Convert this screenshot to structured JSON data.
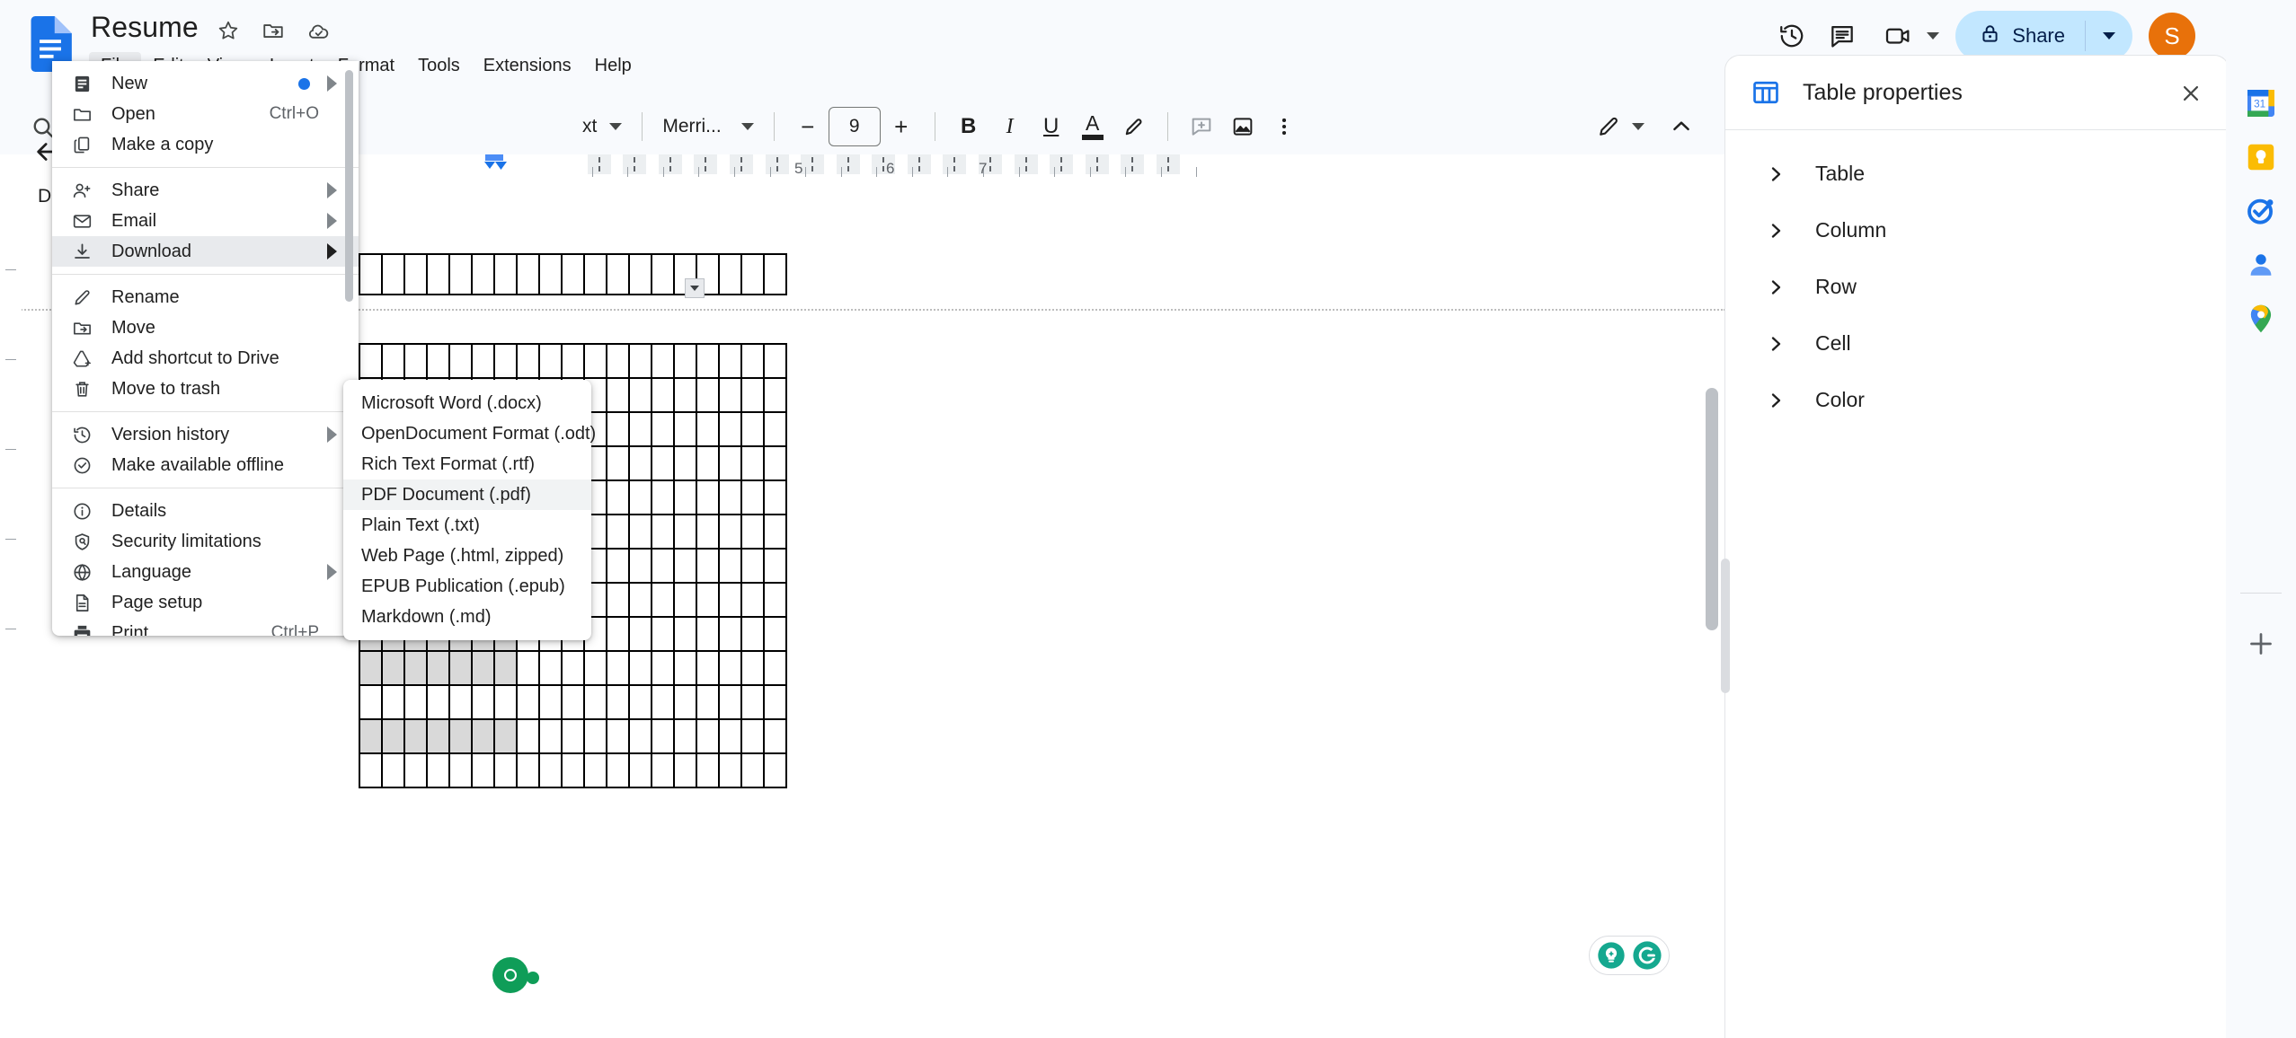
{
  "app": {
    "doc_title": "Resume",
    "logo_icon": "google-docs-logo"
  },
  "title_icons": [
    {
      "name": "star-icon",
      "label": "Star"
    },
    {
      "name": "move-folder-icon",
      "label": "Move"
    },
    {
      "name": "cloud-saved-icon",
      "label": "Saved to Drive"
    }
  ],
  "menubar": {
    "items": [
      {
        "label": "File",
        "active": true
      },
      {
        "label": "Edit",
        "active": false
      },
      {
        "label": "View",
        "active": false
      },
      {
        "label": "Insert",
        "active": false
      },
      {
        "label": "Format",
        "active": false
      },
      {
        "label": "Tools",
        "active": false
      },
      {
        "label": "Extensions",
        "active": false
      },
      {
        "label": "Help",
        "active": false
      }
    ]
  },
  "header_right": {
    "history_icon": "version-history-icon",
    "comment_icon": "comment-icon",
    "meet_icon": "meet-video-icon",
    "share_label": "Share",
    "share_lock_icon": "lock-icon",
    "avatar_initial": "S",
    "avatar_color": "#e8710a",
    "share_bg": "#c2e7ff"
  },
  "toolbar": {
    "search_icon": "search-icon",
    "style_label": "xt",
    "font_label": "Merri...",
    "decrease_label": "−",
    "font_size": "9",
    "increase_label": "+",
    "bold_label": "B",
    "italic_label": "I",
    "underline_label": "U",
    "text_color_label": "A",
    "highlight_icon": "highlight-pen-icon",
    "comment_add_icon": "add-comment-icon",
    "image_icon": "insert-image-icon",
    "more_icon": "more-vertical-icon",
    "edit_mode_icon": "edit-pencil-icon",
    "collapse_icon": "chevron-up-icon"
  },
  "file_menu": {
    "groups": [
      {
        "items": [
          {
            "label": "New",
            "icon": "new-doc-icon",
            "accel": "",
            "arrow": true,
            "dot": true,
            "highlight": false
          },
          {
            "label": "Open",
            "icon": "folder-icon",
            "accel": "Ctrl+O",
            "arrow": false,
            "dot": false,
            "highlight": false
          },
          {
            "label": "Make a copy",
            "icon": "copy-icon",
            "accel": "",
            "arrow": false,
            "dot": false,
            "highlight": false
          }
        ]
      },
      {
        "items": [
          {
            "label": "Share",
            "icon": "person-add-icon",
            "accel": "",
            "arrow": true,
            "dot": false,
            "highlight": false
          },
          {
            "label": "Email",
            "icon": "email-icon",
            "accel": "",
            "arrow": true,
            "dot": false,
            "highlight": false
          },
          {
            "label": "Download",
            "icon": "download-icon",
            "accel": "",
            "arrow": true,
            "dot": false,
            "highlight": true
          }
        ]
      },
      {
        "items": [
          {
            "label": "Rename",
            "icon": "pencil-icon",
            "accel": "",
            "arrow": false,
            "dot": false,
            "highlight": false
          },
          {
            "label": "Move",
            "icon": "move-folder-icon",
            "accel": "",
            "arrow": false,
            "dot": false,
            "highlight": false
          },
          {
            "label": "Add shortcut to Drive",
            "icon": "drive-shortcut-icon",
            "accel": "",
            "arrow": false,
            "dot": false,
            "highlight": false
          },
          {
            "label": "Move to trash",
            "icon": "trash-icon",
            "accel": "",
            "arrow": false,
            "dot": false,
            "highlight": false
          }
        ]
      },
      {
        "items": [
          {
            "label": "Version history",
            "icon": "history-icon",
            "accel": "",
            "arrow": true,
            "dot": false,
            "highlight": false
          },
          {
            "label": "Make available offline",
            "icon": "offline-check-icon",
            "accel": "",
            "arrow": false,
            "dot": false,
            "highlight": false
          }
        ]
      },
      {
        "items": [
          {
            "label": "Details",
            "icon": "info-icon",
            "accel": "",
            "arrow": false,
            "dot": false,
            "highlight": false
          },
          {
            "label": "Security limitations",
            "icon": "shield-icon",
            "accel": "",
            "arrow": false,
            "dot": false,
            "highlight": false
          },
          {
            "label": "Language",
            "icon": "globe-icon",
            "accel": "",
            "arrow": true,
            "dot": false,
            "highlight": false
          },
          {
            "label": "Page setup",
            "icon": "page-setup-icon",
            "accel": "",
            "arrow": false,
            "dot": false,
            "highlight": false
          },
          {
            "label": "Print",
            "icon": "print-icon",
            "accel": "Ctrl+P",
            "arrow": false,
            "dot": false,
            "highlight": false
          }
        ]
      }
    ]
  },
  "download_submenu": {
    "items": [
      {
        "label": "Microsoft Word (.docx)",
        "highlight": false
      },
      {
        "label": "OpenDocument Format (.odt)",
        "highlight": false
      },
      {
        "label": "Rich Text Format (.rtf)",
        "highlight": false
      },
      {
        "label": "PDF Document (.pdf)",
        "highlight": true
      },
      {
        "label": "Plain Text (.txt)",
        "highlight": false
      },
      {
        "label": "Web Page (.html, zipped)",
        "highlight": false
      },
      {
        "label": "EPUB Publication (.epub)",
        "highlight": false
      },
      {
        "label": "Markdown (.md)",
        "highlight": false
      }
    ]
  },
  "ruler": {
    "numbers": [
      "5",
      "6",
      "7"
    ]
  },
  "right_panel": {
    "icon": "table-properties-icon",
    "title": "Table properties",
    "close_icon": "close-icon",
    "sections": [
      {
        "label": "Table"
      },
      {
        "label": "Column"
      },
      {
        "label": "Row"
      },
      {
        "label": "Cell"
      },
      {
        "label": "Color"
      }
    ]
  },
  "right_rail": {
    "items": [
      {
        "name": "google-calendar-icon",
        "label": "Calendar"
      },
      {
        "name": "google-keep-icon",
        "label": "Keep"
      },
      {
        "name": "google-tasks-icon",
        "label": "Tasks"
      },
      {
        "name": "google-contacts-icon",
        "label": "Contacts"
      },
      {
        "name": "google-maps-icon",
        "label": "Maps"
      }
    ],
    "add_label": "+"
  },
  "badges": {
    "grammarly_assist_icon": "grammarly-suggestion-icon",
    "grammarly_icon": "grammarly-logo-icon"
  },
  "sidetext": {
    "letter": "D"
  }
}
